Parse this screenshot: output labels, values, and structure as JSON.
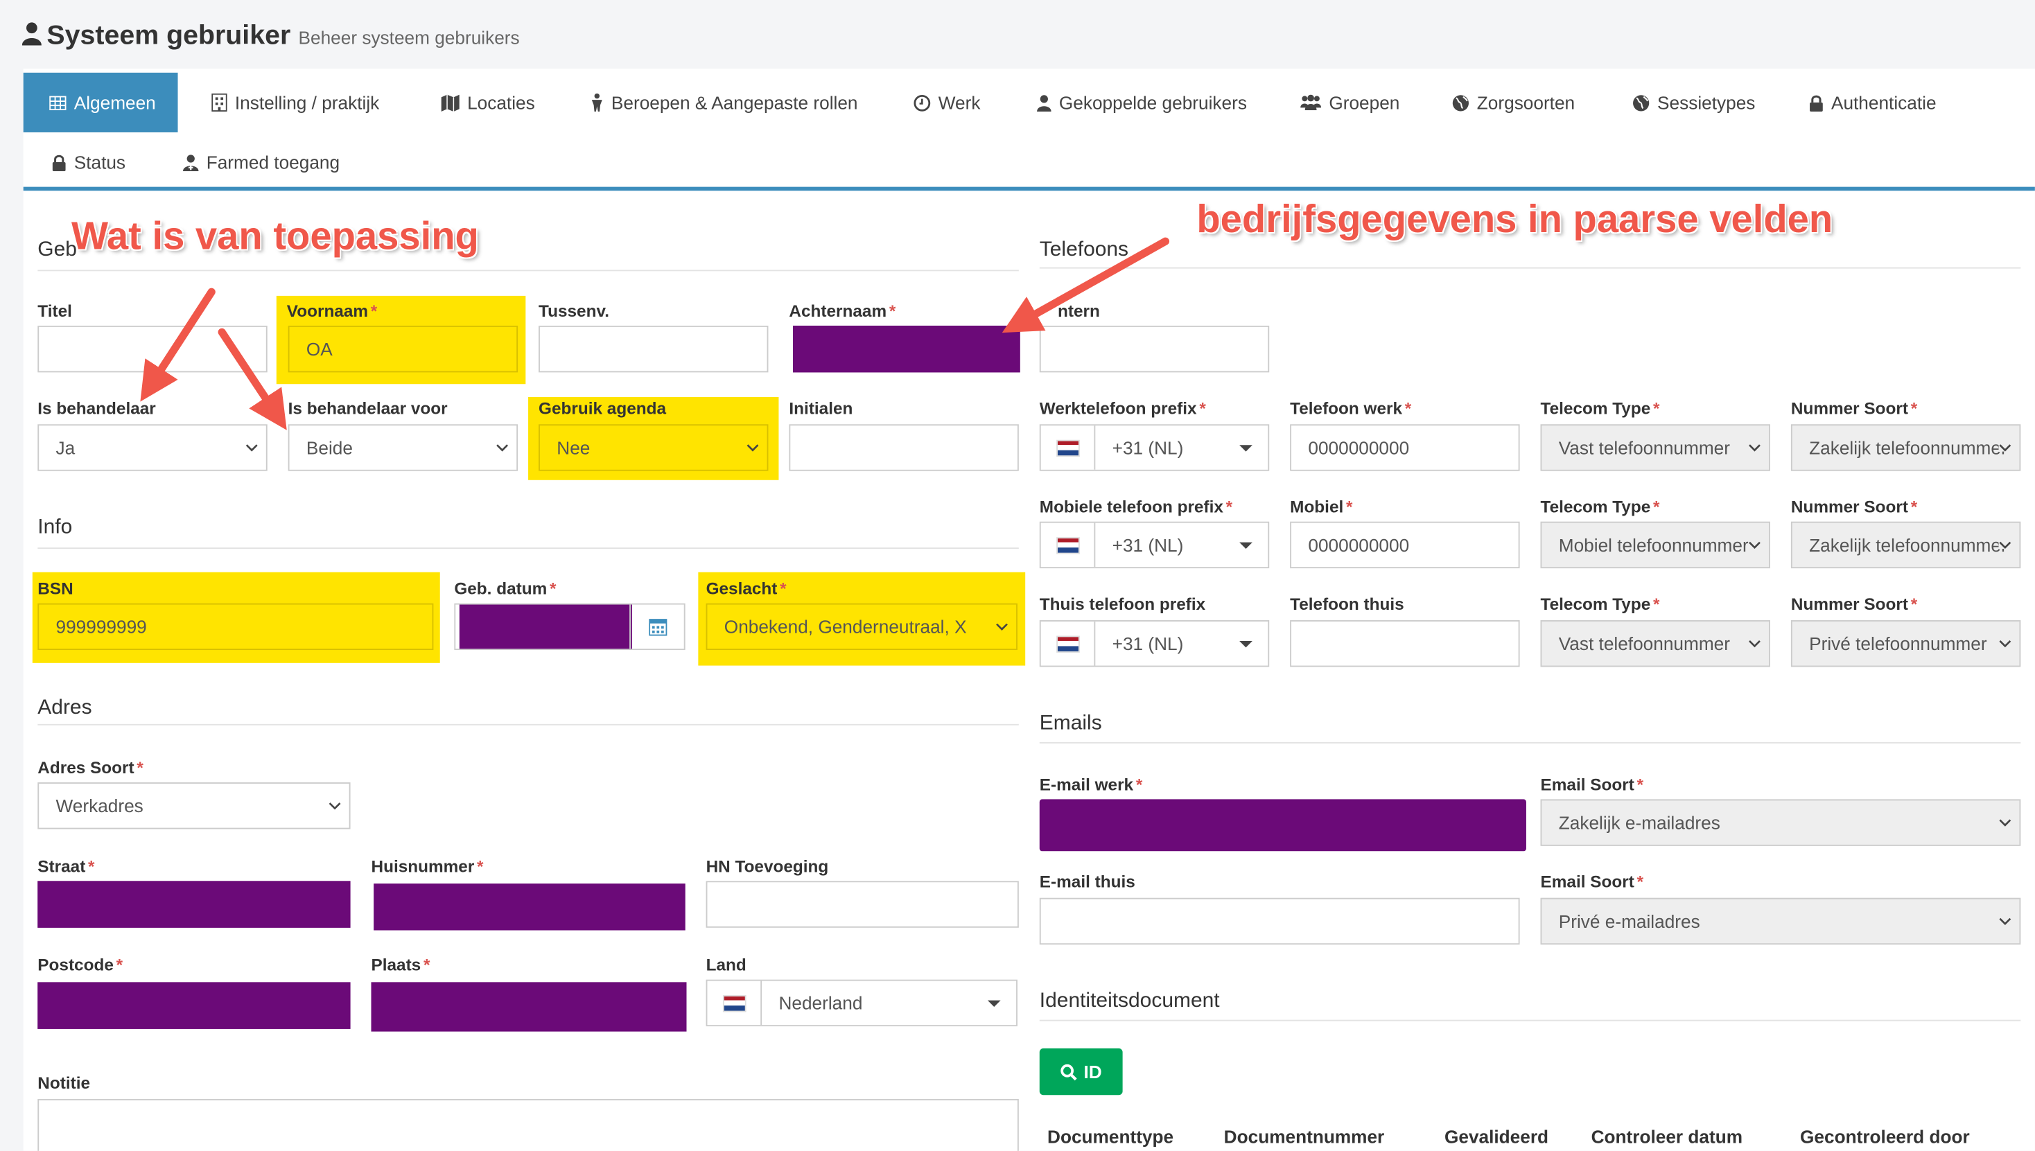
{
  "header": {
    "title": "Systeem gebruiker",
    "subtitle": "Beheer systeem gebruikers"
  },
  "tabs": [
    {
      "label": "Algemeen"
    },
    {
      "label": "Instelling / praktijk"
    },
    {
      "label": "Locaties"
    },
    {
      "label": "Beroepen & Aangepaste rollen"
    },
    {
      "label": "Werk"
    },
    {
      "label": "Gekoppelde gebruikers"
    },
    {
      "label": "Groepen"
    },
    {
      "label": "Zorgsoorten"
    },
    {
      "label": "Sessietypes"
    },
    {
      "label": "Authenticatie"
    },
    {
      "label": "Status"
    },
    {
      "label": "Farmed toegang"
    }
  ],
  "left": {
    "section_gebruiker": "Geb",
    "titel": {
      "label": "Titel",
      "value": ""
    },
    "voornaam": {
      "label": "Voornaam",
      "value": "OA"
    },
    "tussenv": {
      "label": "Tussenv.",
      "value": ""
    },
    "achternaam": {
      "label": "Achternaam",
      "value": ""
    },
    "is_behandelaar": {
      "label": "Is behandelaar",
      "value": "Ja"
    },
    "is_behandelaar_voor": {
      "label": "Is behandelaar voor",
      "value": "Beide"
    },
    "gebruik_agenda": {
      "label": "Gebruik agenda",
      "value": "Nee"
    },
    "initialen": {
      "label": "Initialen",
      "value": ""
    },
    "section_info": "Info",
    "bsn": {
      "label": "BSN",
      "value": "999999999"
    },
    "geb_datum": {
      "label": "Geb. datum",
      "value": ""
    },
    "geslacht": {
      "label": "Geslacht",
      "value": "Onbekend, Genderneutraal, X"
    },
    "section_adres": "Adres",
    "adres_soort": {
      "label": "Adres Soort",
      "value": "Werkadres"
    },
    "straat": {
      "label": "Straat",
      "value": ""
    },
    "huisnummer": {
      "label": "Huisnummer",
      "value": ""
    },
    "hn_toevoeging": {
      "label": "HN Toevoeging",
      "value": ""
    },
    "postcode": {
      "label": "Postcode",
      "value": ""
    },
    "plaats": {
      "label": "Plaats",
      "value": ""
    },
    "land": {
      "label": "Land",
      "value": "Nederland"
    },
    "notitie": {
      "label": "Notitie"
    }
  },
  "right": {
    "section_telefoons": "Telefoons",
    "intern": {
      "label": "ntern",
      "value": ""
    },
    "rows": [
      {
        "prefix_label": "Werktelefoon prefix",
        "prefix_required": true,
        "prefix": "+31 (NL)",
        "tel_label": "Telefoon werk",
        "tel_required": true,
        "tel": "0000000000",
        "type_label": "Telecom Type",
        "type": "Vast telefoonnummer",
        "soort_label": "Nummer Soort",
        "soort": "Zakelijk telefoonnummer"
      },
      {
        "prefix_label": "Mobiele telefoon prefix",
        "prefix_required": true,
        "prefix": "+31 (NL)",
        "tel_label": "Mobiel",
        "tel_required": true,
        "tel": "0000000000",
        "type_label": "Telecom Type",
        "type": "Mobiel telefoonnummer",
        "soort_label": "Nummer Soort",
        "soort": "Zakelijk telefoonnummer"
      },
      {
        "prefix_label": "Thuis telefoon prefix",
        "prefix_required": false,
        "prefix": "+31 (NL)",
        "tel_label": "Telefoon thuis",
        "tel_required": false,
        "tel": "",
        "type_label": "Telecom Type",
        "type": "Vast telefoonnummer",
        "soort_label": "Nummer Soort",
        "soort": "Privé telefoonnummer"
      }
    ],
    "section_emails": "Emails",
    "email_werk": {
      "label": "E-mail werk",
      "value": ""
    },
    "email_soort_1": {
      "label": "Email Soort",
      "value": "Zakelijk e-mailadres"
    },
    "email_thuis": {
      "label": "E-mail thuis",
      "value": ""
    },
    "email_soort_2": {
      "label": "Email Soort",
      "value": "Privé e-mailadres"
    },
    "section_id": "Identiteitsdocument",
    "id_button": "ID",
    "table_headers": [
      "Documenttype",
      "Documentnummer",
      "Gevalideerd",
      "Controleer datum",
      "Gecontroleerd door"
    ]
  },
  "annotations": {
    "left": "Wat is van toepassing",
    "right": "bedrijfsgegevens in paarse velden"
  },
  "colors": {
    "primary": "#3c8dbc",
    "redacted": "#6b0a78",
    "highlight": "#ffe400",
    "success": "#00a65a",
    "annotation": "#f0574a"
  }
}
